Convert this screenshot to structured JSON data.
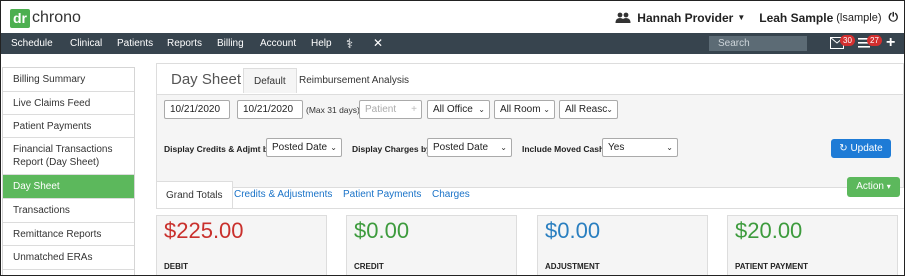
{
  "logo": {
    "box": "dr",
    "text": "chrono"
  },
  "user": {
    "provider": "Hannah Provider",
    "name": "Leah Sample",
    "username": "(lsample)"
  },
  "nav": {
    "items": [
      "Schedule",
      "Clinical",
      "Patients",
      "Reports",
      "Billing",
      "Account",
      "Help"
    ],
    "search_placeholder": "Search",
    "mail_count": "30",
    "list_count": "27"
  },
  "sidebar": {
    "items": [
      {
        "label": "Billing Summary"
      },
      {
        "label": "Live Claims Feed"
      },
      {
        "label": "Patient Payments"
      },
      {
        "label": "Financial Transactions Report (Day Sheet)"
      },
      {
        "label": "Day Sheet"
      },
      {
        "label": "Transactions"
      },
      {
        "label": "Remittance Reports"
      },
      {
        "label": "Unmatched ERAs"
      }
    ],
    "active_index": 4
  },
  "header": {
    "title": "Day Sheet",
    "tabs": [
      "Default",
      "Reimbursement Analysis"
    ]
  },
  "filters": {
    "date_from": "10/21/2020",
    "date_to": "10/21/2020",
    "max_hint": "(Max 31 days)",
    "patient_placeholder": "Patient",
    "office": "All Office",
    "room": "All Room",
    "reason": "All Reasc",
    "credits_label": "Display Credits & Adjmt by",
    "credits_value": "Posted Date",
    "charges_label": "Display Charges by",
    "charges_value": "Posted Date",
    "moved_label": "Include Moved Cash",
    "moved_value": "Yes",
    "update_label": "Update"
  },
  "tabs": [
    "Grand Totals",
    "Credits & Adjustments",
    "Patient Payments",
    "Charges"
  ],
  "action_label": "Action",
  "cards": [
    {
      "value": "$225.00",
      "label": "DEBIT",
      "color": "#c9302c"
    },
    {
      "value": "$0.00",
      "label": "CREDIT",
      "color": "#3d9b3d"
    },
    {
      "value": "$0.00",
      "label": "ADJUSTMENT",
      "color": "#2a7fc0"
    },
    {
      "value": "$20.00",
      "label": "PATIENT PAYMENT",
      "color": "#3d9b3d"
    }
  ]
}
